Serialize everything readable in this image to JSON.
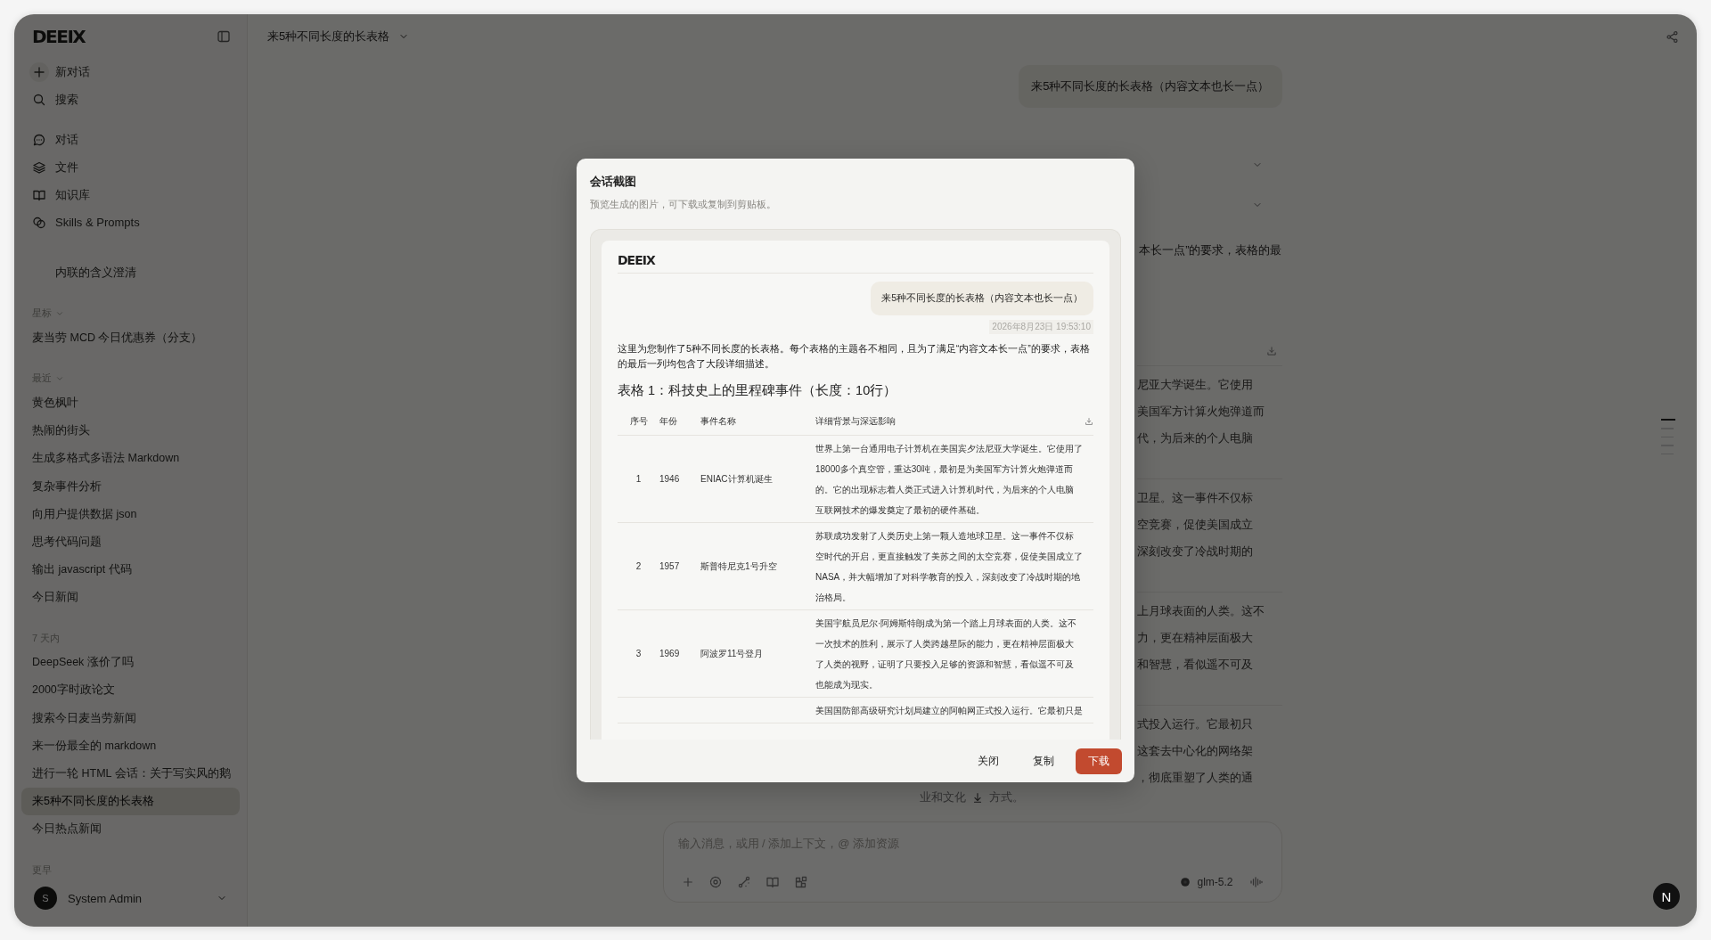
{
  "sidebar": {
    "logo": "DEEIX",
    "actions": [
      {
        "label": "新对话"
      },
      {
        "label": "搜索"
      }
    ],
    "nav": [
      {
        "label": "对话"
      },
      {
        "label": "文件"
      },
      {
        "label": "知识库"
      },
      {
        "label": "Skills & Prompts"
      }
    ],
    "pinned_item": "内联的含义澄清",
    "sections": [
      {
        "title": "星标",
        "collapsible": true,
        "items": [
          {
            "label": "麦当劳 MCD 今日优惠券（分支）",
            "selected": false
          }
        ]
      },
      {
        "title": "最近",
        "collapsible": true,
        "items": [
          {
            "label": "黄色枫叶",
            "selected": false
          },
          {
            "label": "热闹的街头",
            "selected": false
          },
          {
            "label": "生成多格式多语法 Markdown",
            "selected": false
          },
          {
            "label": "复杂事件分析",
            "selected": false
          },
          {
            "label": "向用户提供数据 json",
            "selected": false
          },
          {
            "label": "思考代码问题",
            "selected": false
          },
          {
            "label": "输出 javascript 代码",
            "selected": false
          },
          {
            "label": "今日新闻",
            "selected": false
          }
        ]
      },
      {
        "title": "7 天内",
        "collapsible": false,
        "items": [
          {
            "label": "DeepSeek 涨价了吗",
            "selected": false
          },
          {
            "label": "2000字时政论文",
            "selected": false
          },
          {
            "label": "搜索今日麦当劳新闻",
            "selected": false
          },
          {
            "label": "来一份最全的 markdown",
            "selected": false
          },
          {
            "label": "进行一轮 HTML 会话：关于写实风的鹅",
            "selected": false
          },
          {
            "label": "来5种不同长度的长表格",
            "selected": true
          },
          {
            "label": "今日热点新闻",
            "selected": false
          }
        ]
      },
      {
        "title": "更早",
        "collapsible": false
      }
    ],
    "user": {
      "avatar": "S",
      "name": "System Admin"
    }
  },
  "header": {
    "title": "来5种不同长度的长表格"
  },
  "chat": {
    "user_message": "来5种不同长度的长表格（内容文本也长一点）",
    "paragraph_fragment": "本长一点”的要求，表格的最",
    "table_fragment_rows": [
      [
        "尼亚大学诞生。它使用",
        "美国军方计算火炮弹道而",
        "代，为后来的个人电脑"
      ],
      [
        "卫星。这一事件不仅标",
        "空竞赛，促使美国成立",
        "深刻改变了冷战时期的"
      ],
      [
        "上月球表面的人类。这不",
        "力，更在精神层面极大",
        "和智慧，看似遥不可及"
      ],
      [
        "式投入运行。它最初只",
        "这套去中心化的网络架",
        "，彻底重塑了人类的通"
      ]
    ],
    "trailing_fragments": [
      "业和文化",
      "方式。"
    ]
  },
  "composer": {
    "placeholder": "输入消息，或用 / 添加上下文，@ 添加资源",
    "model": "glm-5.2"
  },
  "floating_button": {
    "label": "N"
  },
  "modal": {
    "title": "会话截图",
    "subtitle": "预览生成的图片，可下载或复制到剪贴板。",
    "preview": {
      "logo": "DEEIX",
      "user_message": "来5种不同长度的长表格（内容文本也长一点）",
      "timestamp": "2026年8月23日 19:53:10",
      "intro": "这里为您制作了5种不同长度的长表格。每个表格的主题各不相同，且为了满足“内容文本长一点”的要求，表格的最后一列均包含了大段详细描述。",
      "heading": "表格 1：科技史上的里程碑事件（长度：10行）",
      "table": {
        "columns": [
          "序号",
          "年份",
          "事件名称",
          "详细背景与深远影响"
        ],
        "rows": [
          {
            "cells": [
              "1",
              "1946",
              "ENIAC计算机诞生"
            ],
            "detail_lines": [
              "世界上第一台通用电子计算机在美国宾夕法尼亚大学诞生。它使用了",
              "18000多个真空管，重达30吨，最初是为美国军方计算火炮弹道而",
              "的。它的出现标志着人类正式进入计算机时代，为后来的个人电脑",
              "互联网技术的爆发奠定了最初的硬件基础。"
            ]
          },
          {
            "cells": [
              "2",
              "1957",
              "斯普特尼克1号升空"
            ],
            "detail_lines": [
              "苏联成功发射了人类历史上第一颗人造地球卫星。这一事件不仅标",
              "空时代的开启，更直接触发了美苏之间的太空竞赛，促使美国成立了",
              "NASA，并大幅增加了对科学教育的投入，深刻改变了冷战时期的地",
              "治格局。"
            ]
          },
          {
            "cells": [
              "3",
              "1969",
              "阿波罗11号登月"
            ],
            "detail_lines": [
              "美国宇航员尼尔·阿姆斯特朗成为第一个踏上月球表面的人类。这不",
              "一次技术的胜利，展示了人类跨越星际的能力，更在精神层面极大",
              "了人类的视野，证明了只要投入足够的资源和智慧，看似遥不可及",
              "也能成为现实。"
            ]
          },
          {
            "detail_lines": [
              "美国国防部高级研究计划局建立的阿帕网正式投入运行。它最初只是"
            ]
          }
        ]
      }
    },
    "buttons": [
      {
        "label": "关闭",
        "kind": "text"
      },
      {
        "label": "复制",
        "kind": "text"
      },
      {
        "label": "下载",
        "kind": "primary"
      }
    ]
  }
}
